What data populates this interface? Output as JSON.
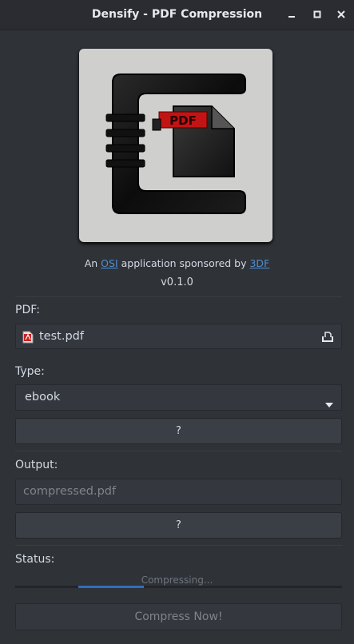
{
  "window": {
    "title": "Densify - PDF Compression"
  },
  "about": {
    "prefix": "An ",
    "osi_link": "OSI",
    "middle": " application sponsored by ",
    "sponsor_link": "3DF",
    "version": "v0.1.0",
    "logo_text": "PDF"
  },
  "pdf": {
    "label": "PDF:",
    "filename": "test.pdf"
  },
  "type": {
    "label": "Type:",
    "selected": "ebook",
    "help_label": "?"
  },
  "output": {
    "label": "Output:",
    "placeholder": "compressed.pdf",
    "help_label": "?"
  },
  "status": {
    "label": "Status:",
    "progress_text": "Compressing...",
    "progress_fraction": 0.2
  },
  "actions": {
    "compress_label": "Compress Now!"
  },
  "colors": {
    "accent": "#2b6fbf",
    "link": "#4f8fd1",
    "background": "#2f3237"
  }
}
